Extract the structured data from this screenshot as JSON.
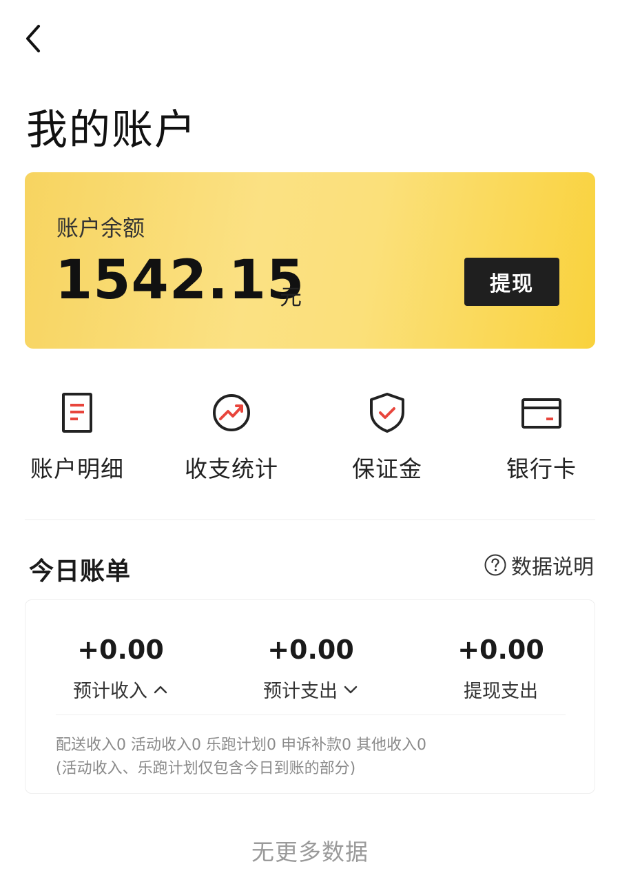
{
  "nav": {
    "back_icon": "chevron-left-icon"
  },
  "page_title": "我的账户",
  "balance": {
    "label": "账户余额",
    "amount": "1542.15",
    "unit": "元",
    "withdraw_label": "提现"
  },
  "shortcuts": [
    {
      "label": "账户明细",
      "icon": "document-icon"
    },
    {
      "label": "收支统计",
      "icon": "trend-chart-icon"
    },
    {
      "label": "保证金",
      "icon": "shield-check-icon"
    },
    {
      "label": "银行卡",
      "icon": "bank-card-icon"
    }
  ],
  "today_bill": {
    "title": "今日账单",
    "help_label": "数据说明",
    "help_icon": "question-circle-icon",
    "stats": [
      {
        "value": "+0.00",
        "label": "预计收入",
        "chevron": "chevron-up-icon"
      },
      {
        "value": "+0.00",
        "label": "预计支出",
        "chevron": "chevron-down-icon"
      },
      {
        "value": "+0.00",
        "label": "提现支出"
      }
    ],
    "note_line1": "配送收入0 活动收入0 乐跑计划0 申诉补款0 其他收入0",
    "note_line2": "(活动收入、乐跑计划仅包含今日到账的部分)"
  },
  "footer": {
    "no_more": "无更多数据"
  },
  "colors": {
    "brand_yellow": "#f9d23c",
    "accent_red": "#e8453c",
    "button_dark": "#1f1f1f"
  }
}
